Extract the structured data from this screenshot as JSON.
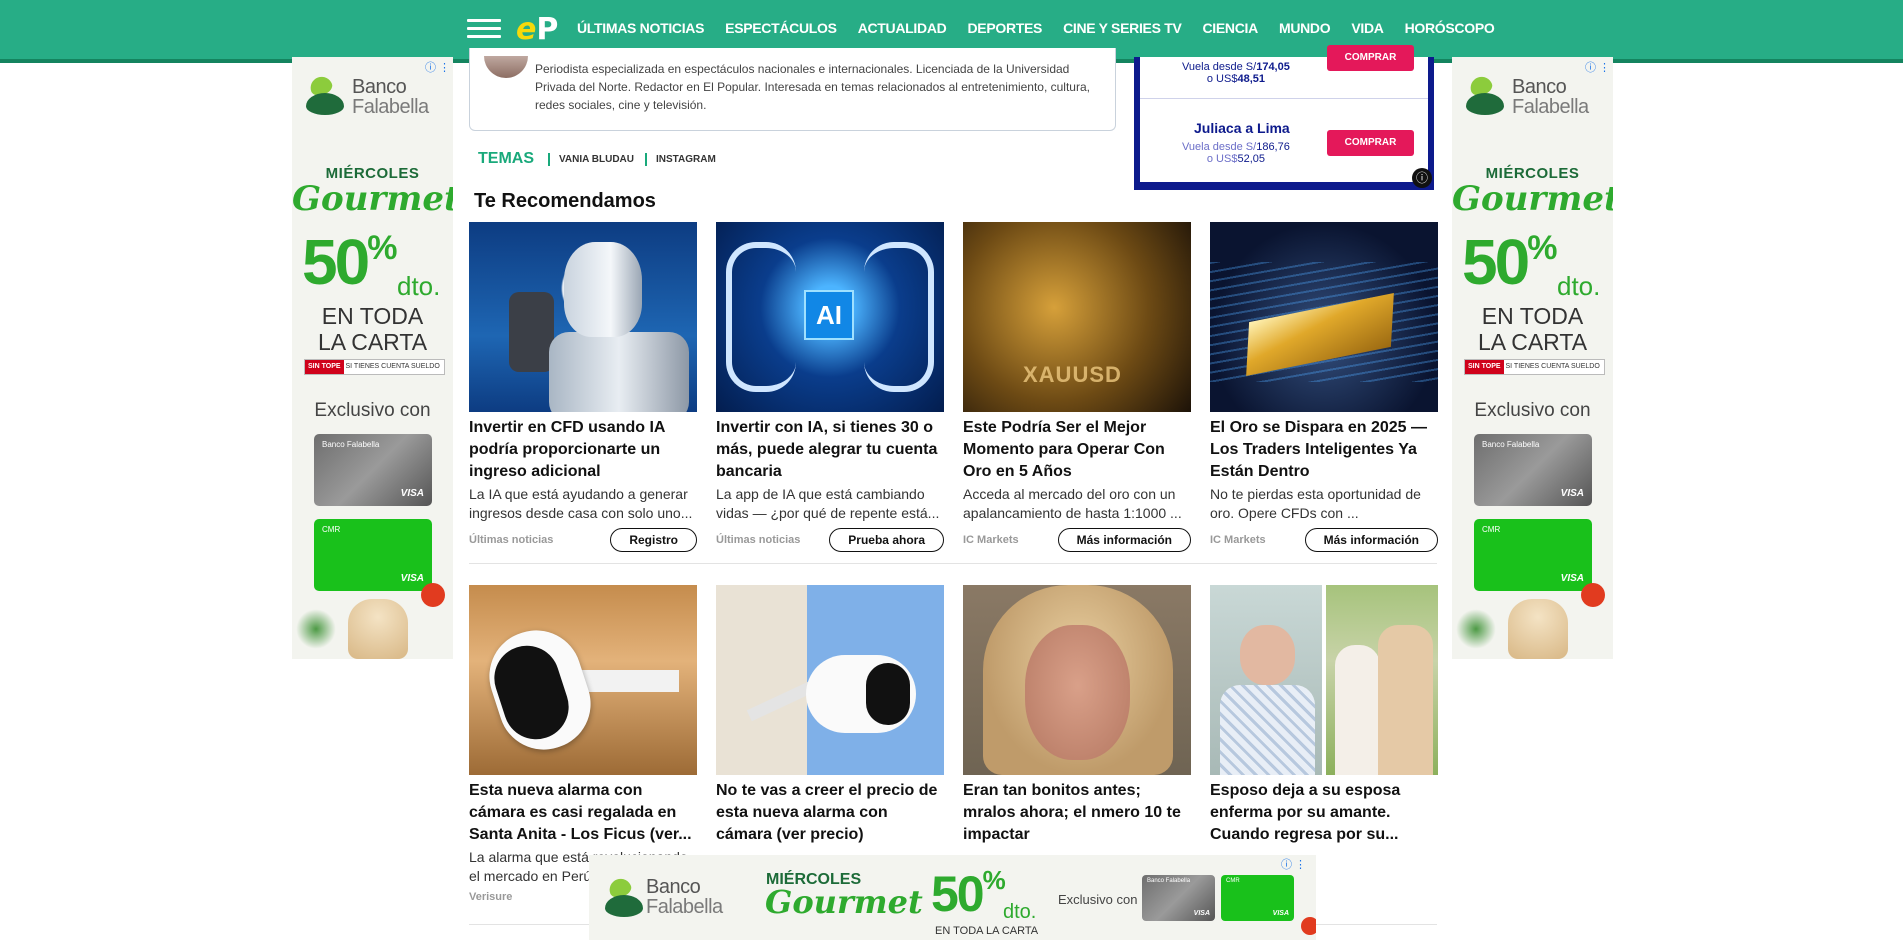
{
  "header": {
    "logo_e": "e",
    "logo_p": "P",
    "nav": [
      "ÚLTIMAS NOTICIAS",
      "ESPECTÁCULOS",
      "ACTUALIDAD",
      "DEPORTES",
      "CINE Y SERIES TV",
      "CIENCIA",
      "MUNDO",
      "VIDA",
      "HORÓSCOPO"
    ],
    "bar_color": "#27ad86"
  },
  "author": {
    "bio": "Periodista especializada en espectáculos nacionales e internacionales. Licenciada de la Universidad Privada del Norte. Redactor en El Popular. Interesada en temas relacionados al entretenimiento, cultura, redes sociales, cine y televisión."
  },
  "temas": {
    "label": "TEMAS",
    "tags": [
      "VANIA BLUDAU",
      "INSTAGRAM"
    ]
  },
  "flight_ad": {
    "row1_from": "Vuela desde S/",
    "row1_price": "174,05",
    "row1_usd_prefix": "o US$",
    "row1_usd": "48,51",
    "button_label": "COMPRAR",
    "route": "Juliaca a Lima",
    "row2_from": "Vuela desde S/",
    "row2_price": "186,76",
    "row2_usd_prefix": "o US$",
    "row2_usd": "52,05",
    "info_icon": "ⓘ"
  },
  "side_ad": {
    "brand_line1": "Banco",
    "brand_line2": "Falabella",
    "miercoles": "MIÉRCOLES",
    "gourmet": "Gourmet",
    "percent": "50",
    "percent_sign": "%",
    "dto": "dto.",
    "en_toda": "EN TODA",
    "la_carta": "LA CARTA",
    "sintope_badge": "SIN TOPE",
    "sintope_text": "SI TIENES CUENTA SUELDO",
    "exclusivo": "Exclusivo con",
    "card1_name": "Banco Falabella",
    "card2_name": "CMR",
    "visa": "VISA",
    "info_icon": "ⓘ ⋮"
  },
  "recommend": {
    "title": "Te Recomendamos",
    "cards": [
      {
        "headline": "Invertir en CFD usando IA podría proporcionarte un ingreso adicional",
        "desc": "La IA que está ayudando a generar ingresos desde casa con solo uno...",
        "source": "Últimas noticias",
        "cta": "Registro"
      },
      {
        "headline": "Invertir con IA, si tienes 30 o más, puede alegrar tu cuenta bancaria",
        "desc": "La app de IA que está cambiando vidas — ¿por qué de repente está...",
        "source": "Últimas noticias",
        "cta": "Prueba ahora"
      },
      {
        "headline": "Este Podría Ser el Mejor Momento para Operar Con Oro en 5 Años",
        "desc": "Acceda al mercado del oro con un apalancamiento de hasta 1:1000 ...",
        "source": "IC Markets",
        "cta": "Más información"
      },
      {
        "headline": "El Oro se Dispara en 2025 — Los Traders Inteligentes Ya Están Dentro",
        "desc": "No te pierdas esta oportunidad de oro. Opere CFDs con ...",
        "source": "IC Markets",
        "cta": "Más información"
      },
      {
        "headline": "Esta nueva alarma con cámara es casi regalada en Santa Anita - Los Ficus (ver...",
        "desc": "La alarma que está revolucionando el mercado en Perú",
        "source": "Verisure",
        "cta": ""
      },
      {
        "headline": "No te vas a creer el precio de esta nueva alarma con cámara (ver precio)",
        "desc": "",
        "source": "",
        "cta": ""
      },
      {
        "headline": "Eran tan bonitos antes; mralos ahora; el nmero 10 te impactar",
        "desc": "",
        "source": "",
        "cta": ""
      },
      {
        "headline": "Esposo deja a su esposa enferma por su amante. Cuando regresa por su...",
        "desc": "",
        "source": "",
        "cta": ""
      }
    ],
    "image_labels": {
      "ai_chip": "AI",
      "gold": "XAUUSD"
    }
  },
  "bottom_ad": {
    "brand_line1": "Banco",
    "brand_line2": "Falabella",
    "miercoles": "MIÉRCOLES",
    "gourmet": "Gourmet",
    "percent": "50",
    "percent_sign": "%",
    "dto": "dto.",
    "en_toda": "EN TODA LA CARTA",
    "exclusivo": "Exclusivo con",
    "card1_name": "Banco Falabella",
    "card2_name": "CMR",
    "visa": "VISA",
    "info_icon": "ⓘ ⋮"
  }
}
